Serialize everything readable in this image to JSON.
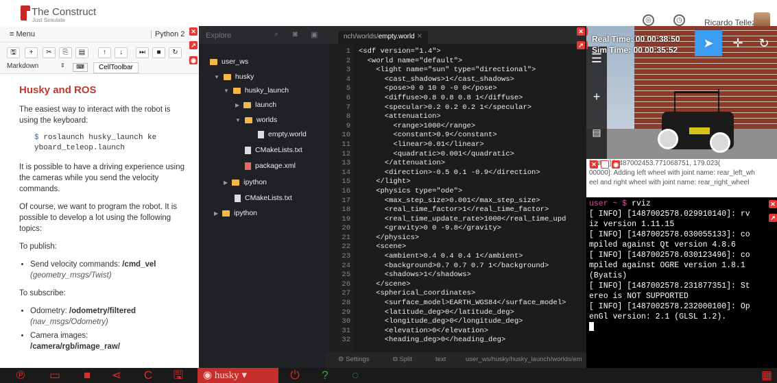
{
  "topbar": {
    "brand": "The Construct",
    "tagline": "Just Simulate",
    "user_name": "Ricardo Tellez",
    "icons": [
      "globe-icon",
      "clock-icon"
    ]
  },
  "notebook": {
    "menu_label": "≡ Menu",
    "kernel_label": "Python 2",
    "toolbar_icons": [
      "save-icon",
      "plus-icon",
      "cut-icon",
      "copy-icon",
      "paste-icon",
      "arrow-up-icon",
      "arrow-down-icon",
      "step-icon",
      "stop-icon",
      "restart-icon"
    ],
    "cell_type": "Markdown",
    "celltoolbar_label": "CellToolbar",
    "heading": "Husky and ROS",
    "para1": "The easiest way to interact with the robot is using the keyboard:",
    "code_prompt": "$",
    "code_line1": "roslaunch husky_launch ke",
    "code_line2": "yboard_teleop.launch",
    "para2": "It is possible to have a driving experience using the cameras while you send the velocity commands.",
    "para3": "Of course, we want to program the robot. It is possible to develop a lot using the following topics:",
    "publish_label": "To publish:",
    "publish_item_text": "Send velocity commands: ",
    "publish_item_topic": "/cmd_vel",
    "publish_item_type": "(geometry_msgs/Twist)",
    "subscribe_label": "To subscribe:",
    "sub1_text": "Odometry: ",
    "sub1_topic": "/odometry/filtered",
    "sub1_type": "(nav_msgs/Odometry)",
    "sub2_text": "Camera images:",
    "sub2_topic": "/camera/rgb/image_raw/"
  },
  "explorer": {
    "title": "Explore",
    "items": [
      {
        "label": "user_ws",
        "kind": "folder"
      },
      {
        "label": "husky",
        "kind": "folder"
      },
      {
        "label": "husky_launch",
        "kind": "folder"
      },
      {
        "label": "launch",
        "kind": "folder"
      },
      {
        "label": "worlds",
        "kind": "folder"
      },
      {
        "label": "empty.world",
        "kind": "file"
      },
      {
        "label": "CMakeLists.txt",
        "kind": "file"
      },
      {
        "label": "package.xml",
        "kind": "file"
      },
      {
        "label": "ipython",
        "kind": "folder"
      },
      {
        "label": "CMakeLists.txt",
        "kind": "file"
      },
      {
        "label": "ipython",
        "kind": "folder"
      }
    ]
  },
  "editor": {
    "tab_prefix": "nch/worlds/",
    "tab_file": "empty.world",
    "lines": [
      "<sdf version=\"1.4\">",
      "  <world name=\"default\">",
      "    <light name=\"sun\" type=\"directional\">",
      "      <cast_shadows>1</cast_shadows>",
      "      <pose>0 0 10 0 -0 0</pose>",
      "      <diffuse>0.8 0.8 0.8 1</diffuse>",
      "      <specular>0.2 0.2 0.2 1</specular>",
      "      <attenuation>",
      "        <range>1000</range>",
      "        <constant>0.9</constant>",
      "        <linear>0.01</linear>",
      "        <quadratic>0.001</quadratic>",
      "      </attenuation>",
      "      <direction>-0.5 0.1 -0.9</direction>",
      "    </light>",
      "    <physics type=\"ode\">",
      "      <max_step_size>0.001</max_step_size>",
      "      <real_time_factor>1</real_time_factor>",
      "      <real_time_update_rate>1000</real_time_upd",
      "      <gravity>0 0 -9.8</gravity>",
      "    </physics>",
      "    <scene>",
      "      <ambient>0.4 0.4 0.4 1</ambient>",
      "      <background>0.7 0.7 0.7 1</background>",
      "      <shadows>1</shadows>",
      "    </scene>",
      "    <spherical_coordinates>",
      "      <surface_model>EARTH_WGS84</surface_model>",
      "      <latitude_deg>0</latitude_deg>",
      "      <longitude_deg>0</longitude_deg>",
      "      <elevation>0</elevation>",
      "      <heading_deg>0</heading_deg>"
    ],
    "status_settings": "Settings",
    "status_split": "Split",
    "status_mode": "text",
    "status_path": "user_ws/husky/husky_launch/worlds/em"
  },
  "viewer": {
    "real_time": "Real Time: 00 00:38:50",
    "sim_time": "Sim Time: 00 00:35:52"
  },
  "log": {
    "line1": "[ INFO] [1487002453.771068751, 179.023(",
    "line2": "00000]: Adding left wheel with joint name: rear_left_wh",
    "line3": "eel and right wheel with joint name: rear_right_wheel"
  },
  "terminal": {
    "prompt": "user ~ $",
    "command": " rviz",
    "output": "[ INFO] [1487002578.029910140]: rv\niz version 1.11.15\n[ INFO] [1487002578.030055133]: co\nmpiled against Qt version 4.8.6\n[ INFO] [1487002578.030123496]: co\nmpiled against OGRE version 1.8.1\n(Byatis)\n[ INFO] [1487002578.231877351]: St\nereo is NOT SUPPORTED\n[ INFO] [1487002578.232000100]: Op\nenGl version: 2.1 (GLSL 1.2)."
  },
  "bottombar": {
    "robot_label": "husky",
    "accent": "#d9302c"
  }
}
